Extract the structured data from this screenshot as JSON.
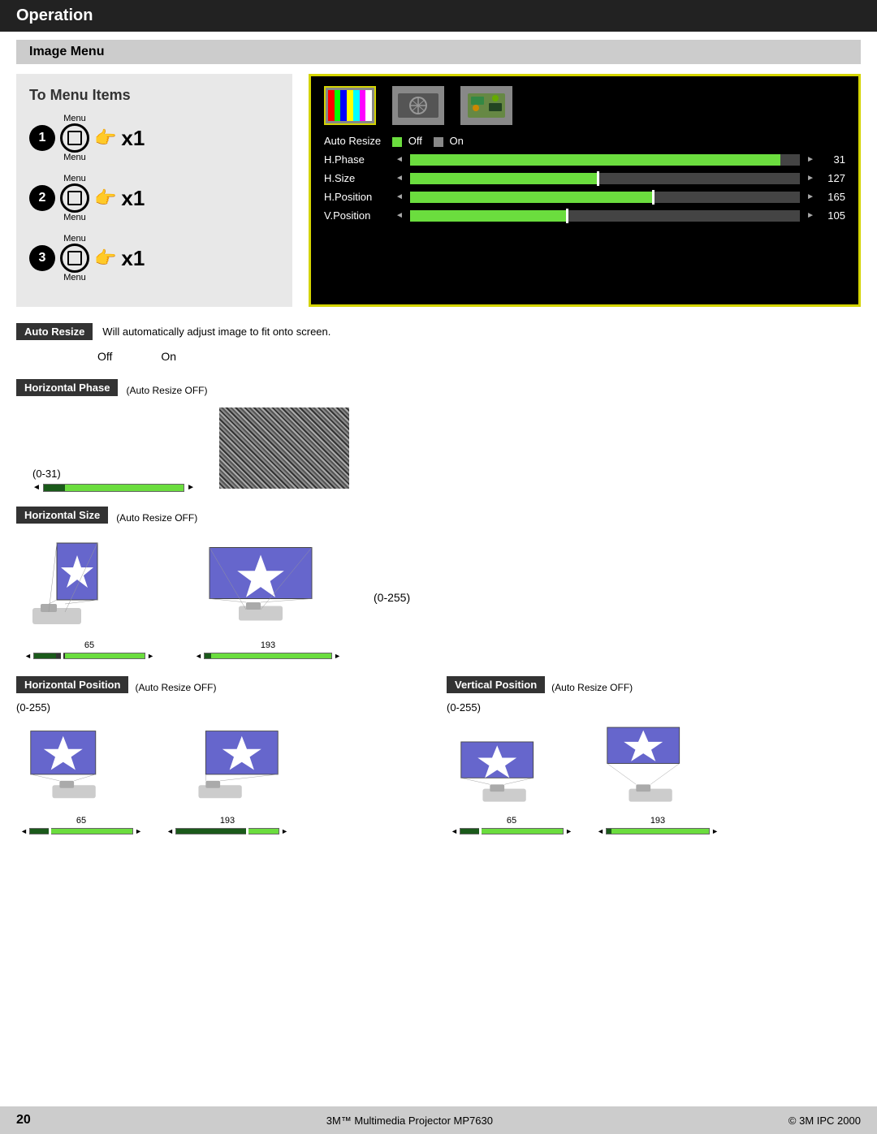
{
  "header": {
    "title": "Operation"
  },
  "section": {
    "title": "Image Menu"
  },
  "menu_steps": {
    "title": "To Menu Items",
    "steps": [
      {
        "number": "1",
        "top_label": "Menu",
        "bottom_label": "Menu",
        "x": "x1"
      },
      {
        "number": "2",
        "top_label": "Menu",
        "bottom_label": "Menu",
        "x": "x1"
      },
      {
        "number": "3",
        "top_label": "Menu",
        "bottom_label": "Menu",
        "x": "x1"
      }
    ]
  },
  "osd": {
    "auto_resize": {
      "label": "Auto Resize",
      "off_label": "Off",
      "on_label": "On"
    },
    "rows": [
      {
        "label": "H.Phase",
        "value": 31,
        "fill_pct": 95
      },
      {
        "label": "H.Size",
        "value": 127,
        "fill_pct": 45
      },
      {
        "label": "H.Position",
        "value": 165,
        "fill_pct": 60
      },
      {
        "label": "V.Position",
        "value": 105,
        "fill_pct": 40
      }
    ]
  },
  "items": {
    "auto_resize": {
      "label": "Auto Resize",
      "description": "Will automatically adjust image to fit onto screen.",
      "off_label": "Off",
      "on_label": "On"
    },
    "horizontal_phase": {
      "label": "Horizontal Phase",
      "note": "(Auto Resize OFF)",
      "range": "(0-31)"
    },
    "horizontal_size": {
      "label": "Horizontal Size",
      "note": "(Auto Resize OFF)",
      "range": "(0-255)",
      "val_left": "65",
      "val_right": "193"
    },
    "horizontal_position": {
      "label": "Horizontal Position",
      "note": "(Auto Resize OFF)",
      "range": "(0-255)",
      "val_left": "65",
      "val_right": "193"
    },
    "vertical_position": {
      "label": "Vertical Position",
      "note": "(Auto Resize OFF)",
      "range": "(0-255)",
      "val_left": "65",
      "val_right": "193"
    }
  },
  "footer": {
    "page_number": "20",
    "center_text": "3M™ Multimedia Projector MP7630",
    "right_text": "© 3M IPC 2000"
  }
}
